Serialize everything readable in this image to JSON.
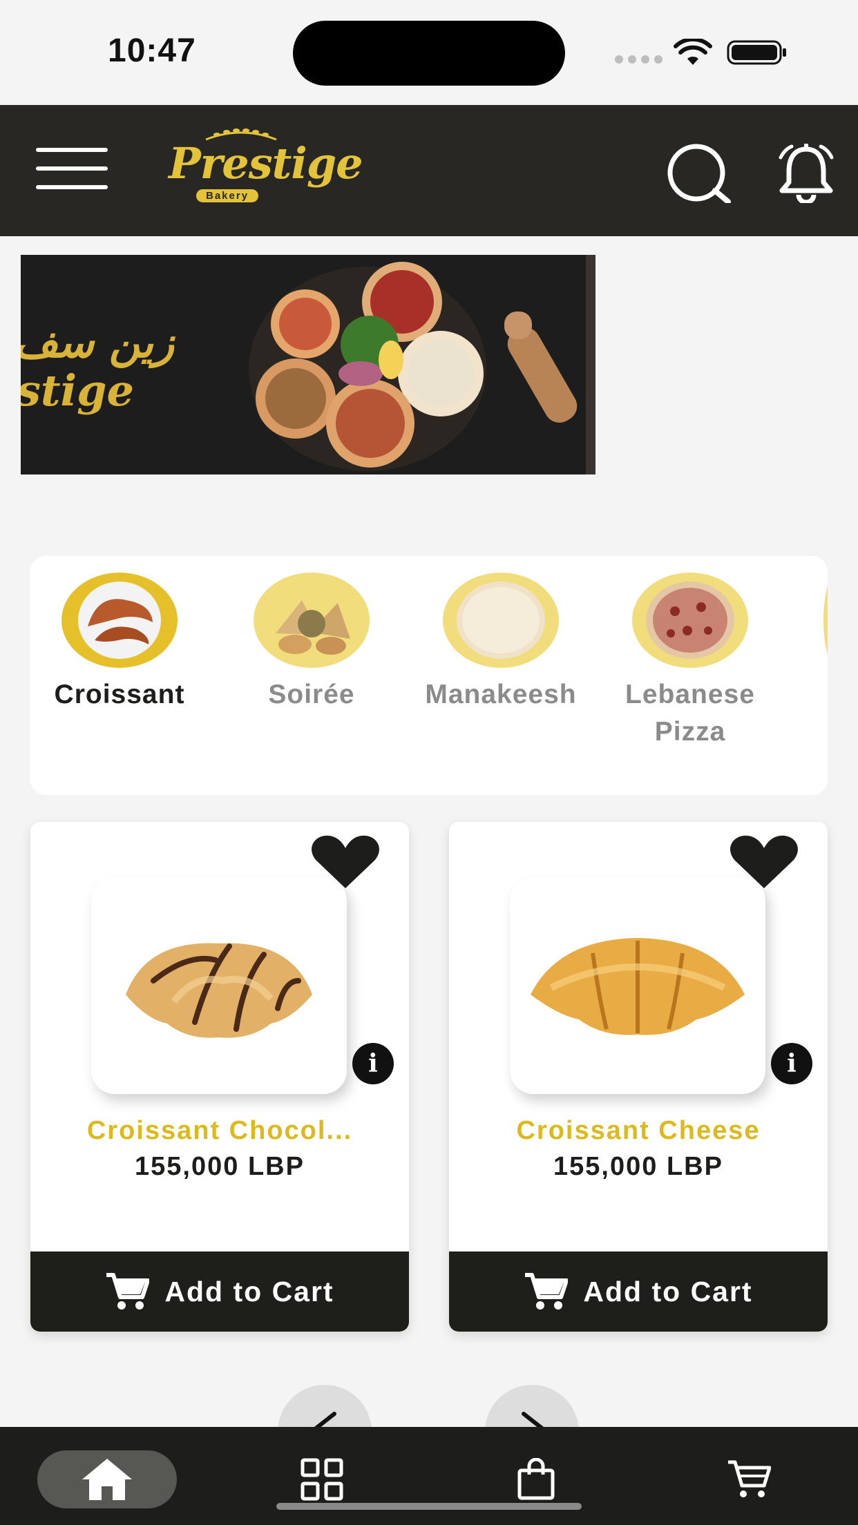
{
  "status_bar": {
    "time": "10:47"
  },
  "header": {
    "logo_name": "Prestige",
    "logo_sub": "Bakery",
    "icons": [
      "menu-icon",
      "search-icon",
      "bell-icon"
    ]
  },
  "banner": {
    "arabic_text": "زين سف",
    "latin_text": "stige"
  },
  "categories": [
    {
      "label": "Croissant",
      "active": true
    },
    {
      "label": "Soirée",
      "active": false
    },
    {
      "label": "Manakeesh",
      "active": false
    },
    {
      "label": "Lebanese Pizza",
      "active": false
    }
  ],
  "products": [
    {
      "name": "Croissant Chocol...",
      "price": "155,000 LBP",
      "button": "Add to Cart"
    },
    {
      "name": "Croissant Cheese",
      "price": "155,000 LBP",
      "button": "Add to Cart"
    }
  ],
  "pagination": {
    "prev_icon": "chevron-left-icon",
    "next_icon": "chevron-right-icon"
  },
  "bottom_nav": [
    "home-icon",
    "grid-icon",
    "bag-icon",
    "cart-icon"
  ],
  "colors": {
    "header_bg": "#282724",
    "accent_gold": "#dcba1f",
    "dark": "#1e1e1b",
    "page_bg": "#f4f4f4"
  }
}
